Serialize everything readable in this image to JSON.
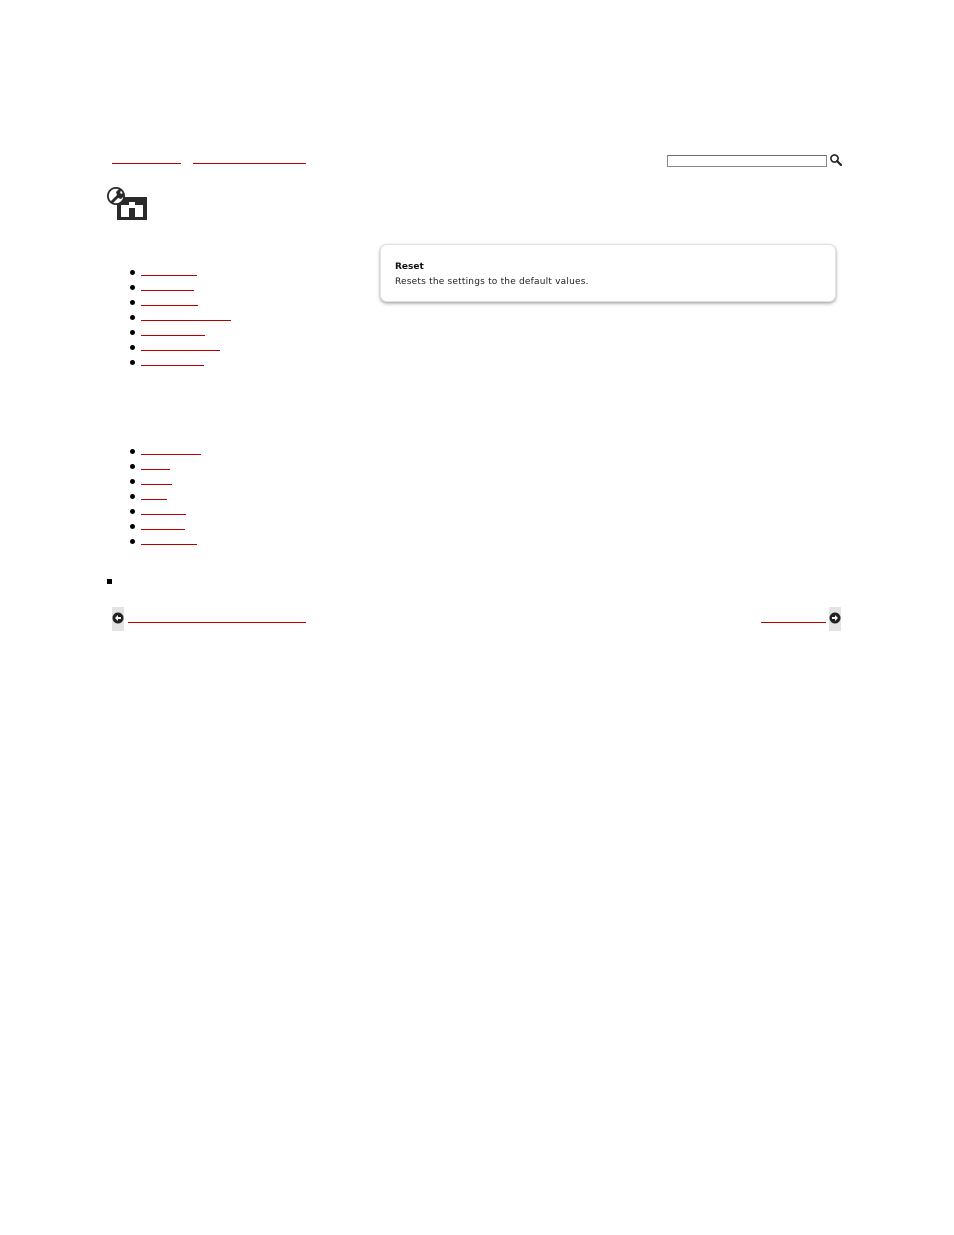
{
  "breadcrumb": [
    {
      "label": ""
    },
    {
      "label": ""
    }
  ],
  "search": {
    "placeholder": "",
    "value": "",
    "button_icon": "magnifier-icon"
  },
  "page_icon": "wrench-settings-icon",
  "nav_group_1": [
    {
      "label": ""
    },
    {
      "label": ""
    },
    {
      "label": ""
    },
    {
      "label": ""
    },
    {
      "label": ""
    },
    {
      "label": ""
    },
    {
      "label": ""
    }
  ],
  "nav_group_2": [
    {
      "label": ""
    },
    {
      "label": ""
    },
    {
      "label": ""
    },
    {
      "label": ""
    },
    {
      "label": ""
    },
    {
      "label": ""
    },
    {
      "label": ""
    }
  ],
  "card": {
    "title": "Reset",
    "description": "Resets the settings to the default values."
  },
  "footer": {
    "prev_label": "",
    "next_label": "",
    "prev_icon": "arrow-left-icon",
    "next_icon": "arrow-right-icon"
  },
  "colors": {
    "link_underline": "#b30000",
    "card_border": "#e4e4e4",
    "arrow_bg": "#e3e3e3"
  }
}
